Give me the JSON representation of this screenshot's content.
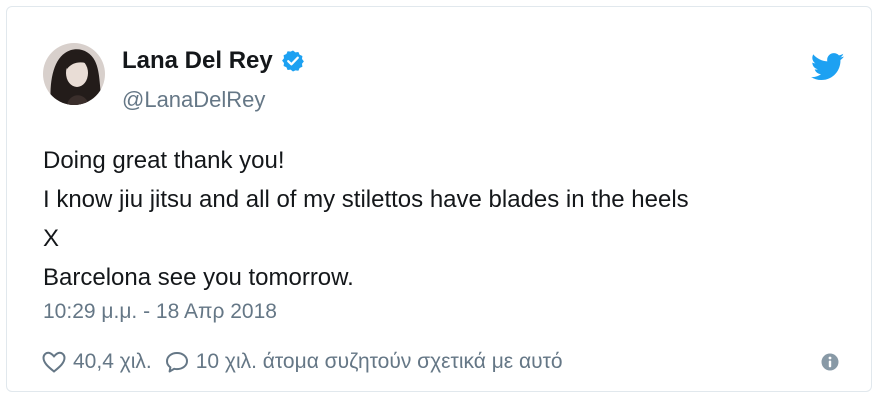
{
  "author": {
    "name": "Lana Del Rey",
    "handle": "@LanaDelRey",
    "verified": true
  },
  "tweet": {
    "lines": [
      "Doing great thank you!",
      "I know jiu jitsu and all of my stilettos have blades in the heels",
      "X",
      "Barcelona see you tomorrow."
    ],
    "timestamp": "10:29 μ.μ. - 18 Απρ 2018"
  },
  "actions": {
    "likes": "40,4 χιλ.",
    "replies": "10 χιλ. άτομα συζητούν σχετικά με αυτό"
  },
  "icons": {
    "brand": "twitter-bird-icon",
    "verified": "verified-badge-icon",
    "like": "heart-icon",
    "reply": "reply-bubble-icon",
    "info": "info-icon"
  },
  "colors": {
    "twitter_blue": "#1da1f2",
    "text": "#14171a",
    "muted": "#657786",
    "border": "#e1e8ed"
  }
}
